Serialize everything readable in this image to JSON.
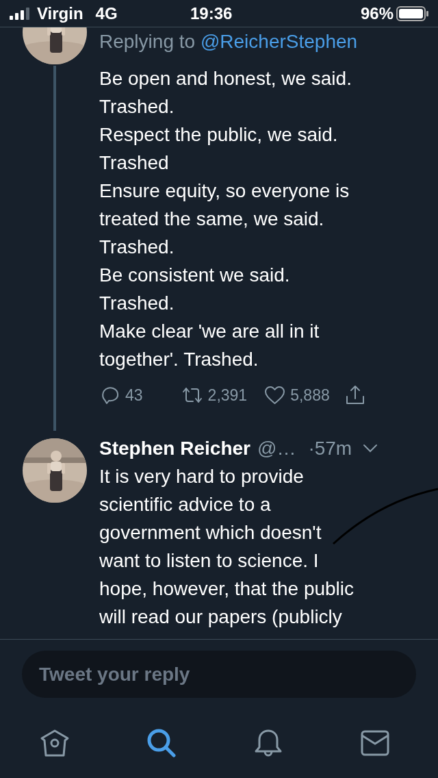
{
  "status_bar": {
    "carrier": "Virgin",
    "network": "4G",
    "time": "19:36",
    "battery": "96%"
  },
  "tweets": [
    {
      "replying_to_prefix": "Replying to",
      "replying_to_handle": "@ReicherStephen",
      "lines": [
        "Be open and honest, we said.",
        "Trashed.",
        "Respect the public, we said.",
        "Trashed",
        "Ensure equity, so everyone is",
        "treated the same, we said.",
        "Trashed.",
        "Be consistent we said.",
        "Trashed.",
        "Make clear 'we are all in it",
        "together'. Trashed."
      ],
      "actions": {
        "replies": "43",
        "retweets": "2,391",
        "likes": "5,888"
      }
    },
    {
      "name": "Stephen Reicher",
      "handle": "@…",
      "time": "·57m",
      "lines": [
        "It is very hard to provide",
        "scientific advice to a",
        "government which doesn't",
        "want to listen to science. I",
        "hope, however, that the public",
        "will read our papers (publicly"
      ]
    }
  ],
  "compose": {
    "placeholder": "Tweet your reply"
  },
  "tab_bar": [
    {
      "kind": "home",
      "selected": false
    },
    {
      "kind": "search",
      "selected": true
    },
    {
      "kind": "notifications",
      "selected": false
    },
    {
      "kind": "messages",
      "selected": false
    }
  ]
}
